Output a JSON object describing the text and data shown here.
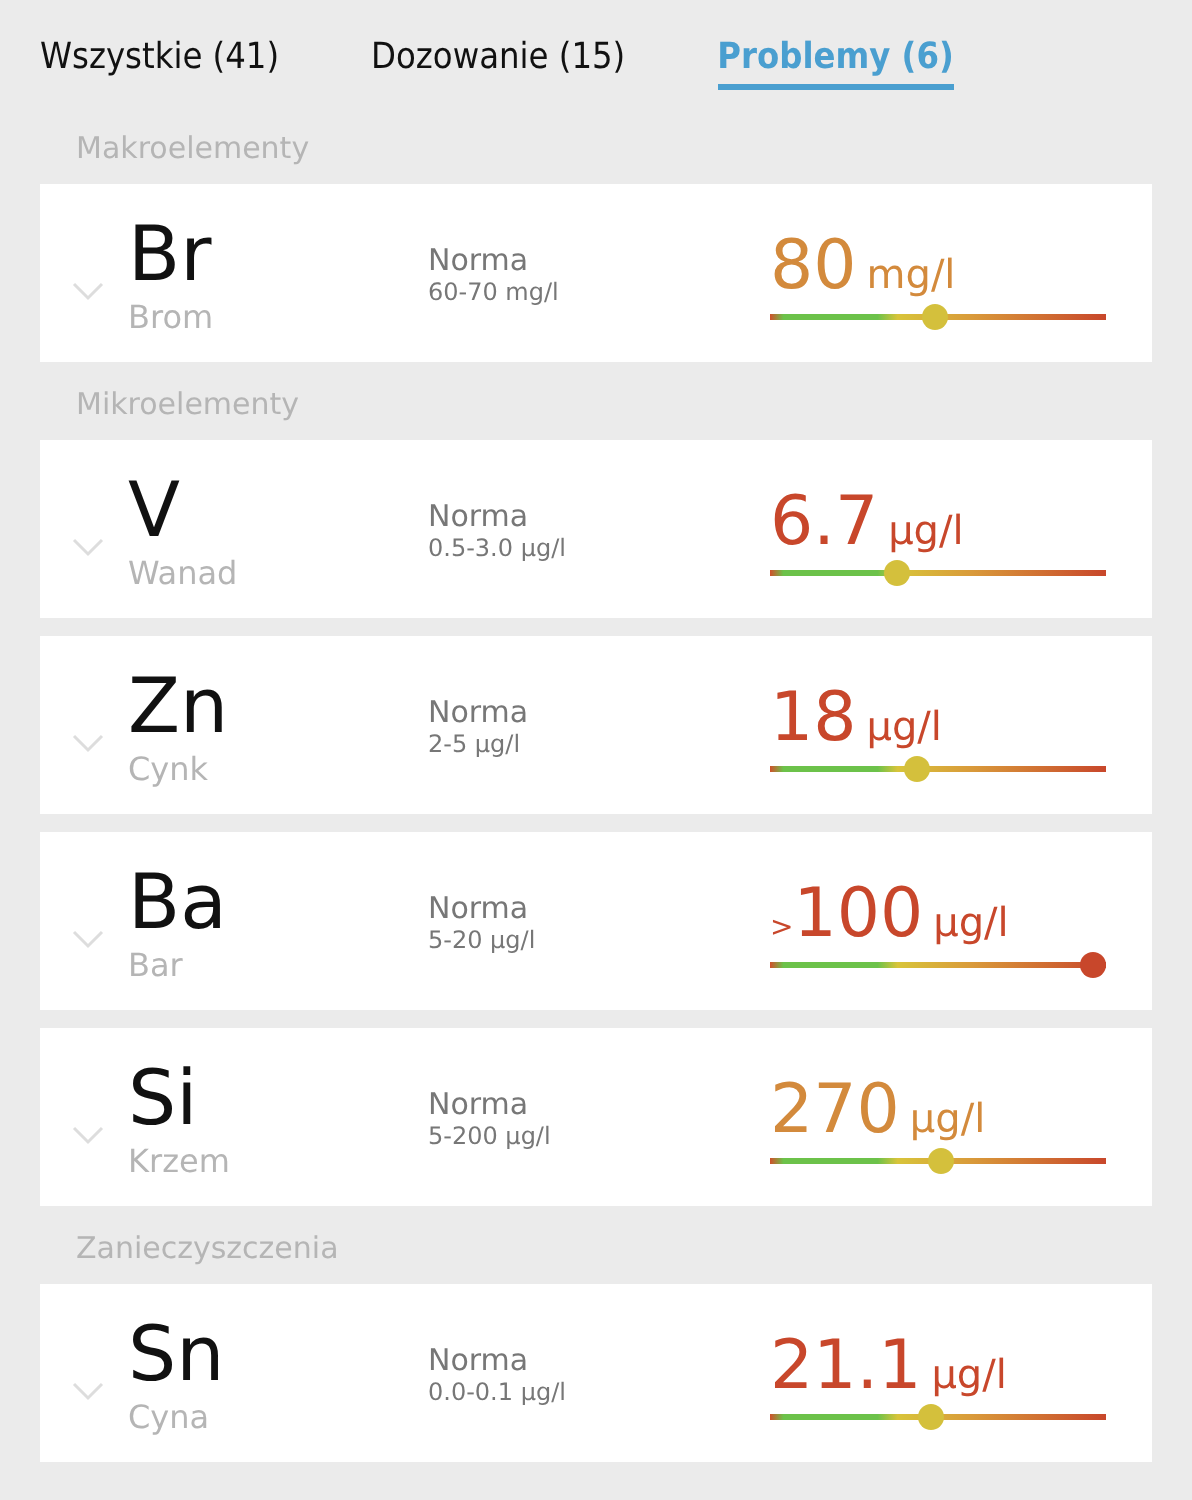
{
  "tabs": [
    {
      "label": "Wszystkie (41)",
      "selected": false
    },
    {
      "label": "Dozowanie (15)",
      "selected": false
    },
    {
      "label": "Problemy (6)",
      "selected": true
    }
  ],
  "sections": [
    {
      "title": "Makroelementy",
      "items": [
        {
          "symbol": "Br",
          "name": "Brom",
          "norm_label": "Norma",
          "norm": "60-70 mg/l",
          "value": "80",
          "unit": "mg/l",
          "color": "#d38a3c",
          "level": 0.49
        }
      ]
    },
    {
      "title": "Mikroelementy",
      "items": [
        {
          "symbol": "V",
          "name": "Wanad",
          "norm_label": "Norma",
          "norm": "0.5-3.0 µg/l",
          "value": "6.7",
          "unit": "µg/l",
          "color": "#c8472b",
          "level": 0.37
        },
        {
          "symbol": "Zn",
          "name": "Cynk",
          "norm_label": "Norma",
          "norm": "2-5 µg/l",
          "value": "18",
          "unit": "µg/l",
          "color": "#c8472b",
          "level": 0.43
        },
        {
          "symbol": "Ba",
          "name": "Bar",
          "norm_label": "Norma",
          "norm": "5-20 µg/l",
          "prefix": ">",
          "value": "100",
          "unit": "µg/l",
          "color": "#c8472b",
          "level": 1
        },
        {
          "symbol": "Si",
          "name": "Krzem",
          "norm_label": "Norma",
          "norm": "5-200 µg/l",
          "value": "270",
          "unit": "µg/l",
          "color": "#d38a3c",
          "level": 0.51
        }
      ]
    },
    {
      "title": "Zanieczyszczenia",
      "items": [
        {
          "symbol": "Sn",
          "name": "Cyna",
          "norm_label": "Norma",
          "norm": "0.0-0.1 µg/l",
          "value": "21.1",
          "unit": "µg/l",
          "color": "#c8472b",
          "level": 0.48
        }
      ]
    }
  ]
}
